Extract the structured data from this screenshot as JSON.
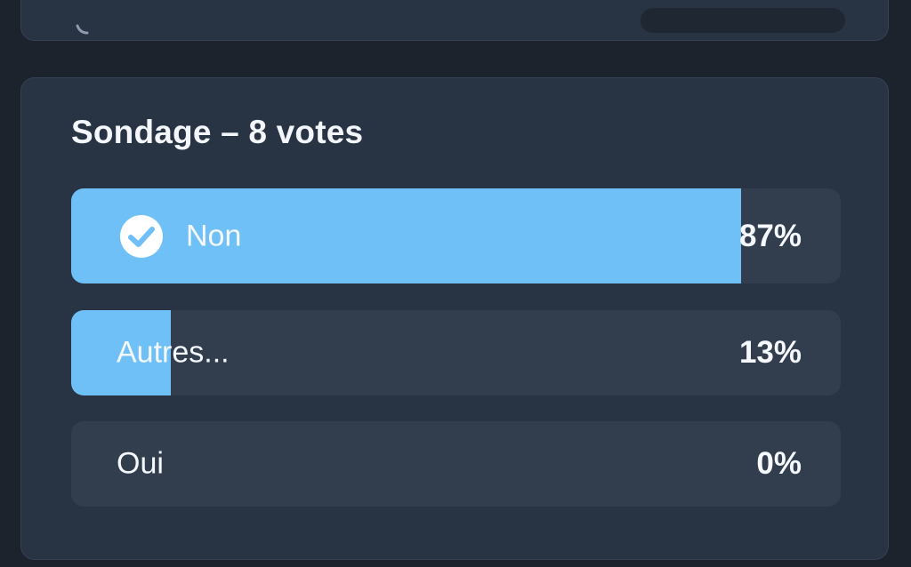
{
  "poll": {
    "title": "Sondage – 8 votes",
    "options": [
      {
        "label": "Non",
        "percent_label": "87%",
        "percent": 87,
        "selected": true
      },
      {
        "label": "Autres...",
        "percent_label": "13%",
        "percent": 13,
        "selected": false
      },
      {
        "label": "Oui",
        "percent_label": "0%",
        "percent": 0,
        "selected": false
      }
    ]
  },
  "colors": {
    "background": "#1d232d",
    "card": "#283343",
    "track": "#323d4e",
    "fill": "#6fc0f7",
    "text": "#f5f8fc"
  },
  "icons": {
    "selected_option": "check-circle-icon"
  }
}
